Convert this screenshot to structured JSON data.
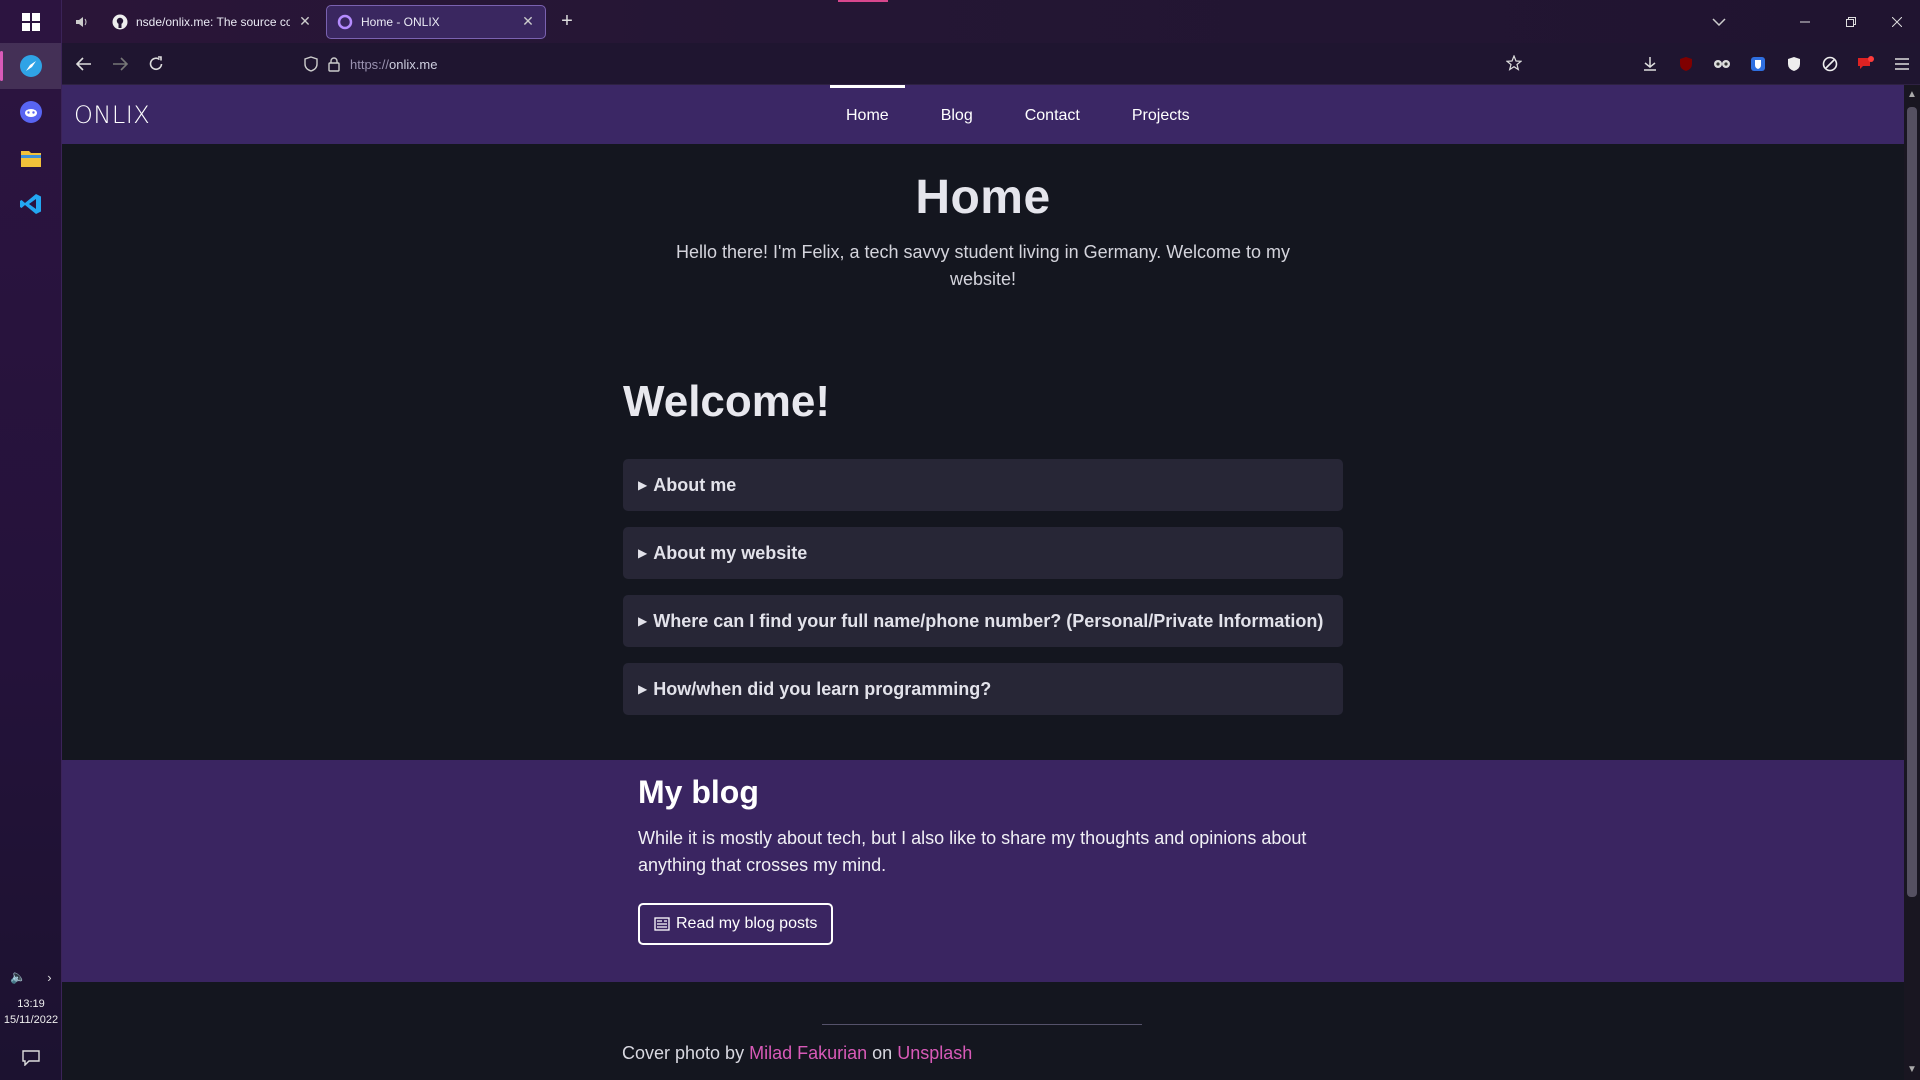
{
  "taskbar": {
    "clock_time": "13:19",
    "clock_date": "15/11/2022",
    "apps": [
      "browser-icon",
      "discord-icon",
      "file-explorer-icon",
      "vscode-icon"
    ]
  },
  "browser": {
    "tabs": [
      {
        "title": "nsde/onlix.me: The source code",
        "icon": "github-icon",
        "active": false
      },
      {
        "title": "Home - ONLIX",
        "icon": "onlix-icon",
        "active": true
      }
    ],
    "url_protocol": "https://",
    "url_host": "onlix.me"
  },
  "site": {
    "brand": "ONLIX",
    "nav": [
      "Home",
      "Blog",
      "Contact",
      "Projects"
    ],
    "hero_title": "Home",
    "hero_text": "Hello there! I'm Felix, a tech savvy student living in Germany. Welcome to my website!",
    "welcome_title": "Welcome!",
    "faq": [
      "About me",
      "About my website",
      "Where can I find your full name/phone number? (Personal/Private Information)",
      "How/when did you learn programming?"
    ],
    "blog_title": "My blog",
    "blog_text": "While it is mostly about tech, but I also like to share my thoughts and opinions about anything that crosses my mind.",
    "blog_button": "Read my blog posts",
    "footer_prefix": "Cover photo by",
    "footer_author": "Milad Fakurian",
    "footer_mid": "on",
    "footer_site": "Unsplash"
  },
  "colors": {
    "accent": "#d85ab8",
    "header": "#3b2765",
    "blog_band": "#3a2561",
    "page_bg": "#14161f"
  }
}
